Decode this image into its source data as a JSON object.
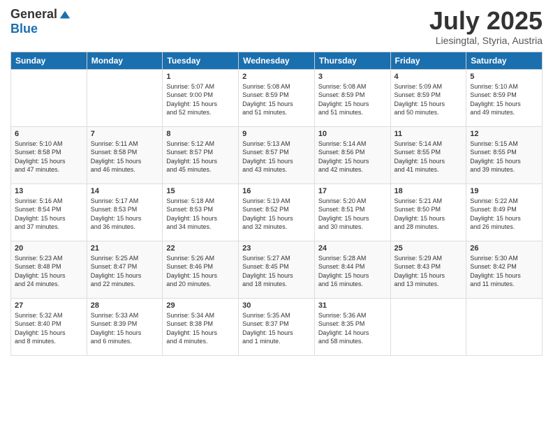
{
  "logo": {
    "general": "General",
    "blue": "Blue"
  },
  "header": {
    "month": "July 2025",
    "location": "Liesingtal, Styria, Austria"
  },
  "days": [
    "Sunday",
    "Monday",
    "Tuesday",
    "Wednesday",
    "Thursday",
    "Friday",
    "Saturday"
  ],
  "weeks": [
    [
      {
        "day": "",
        "content": ""
      },
      {
        "day": "",
        "content": ""
      },
      {
        "day": "1",
        "content": "Sunrise: 5:07 AM\nSunset: 9:00 PM\nDaylight: 15 hours\nand 52 minutes."
      },
      {
        "day": "2",
        "content": "Sunrise: 5:08 AM\nSunset: 8:59 PM\nDaylight: 15 hours\nand 51 minutes."
      },
      {
        "day": "3",
        "content": "Sunrise: 5:08 AM\nSunset: 8:59 PM\nDaylight: 15 hours\nand 51 minutes."
      },
      {
        "day": "4",
        "content": "Sunrise: 5:09 AM\nSunset: 8:59 PM\nDaylight: 15 hours\nand 50 minutes."
      },
      {
        "day": "5",
        "content": "Sunrise: 5:10 AM\nSunset: 8:59 PM\nDaylight: 15 hours\nand 49 minutes."
      }
    ],
    [
      {
        "day": "6",
        "content": "Sunrise: 5:10 AM\nSunset: 8:58 PM\nDaylight: 15 hours\nand 47 minutes."
      },
      {
        "day": "7",
        "content": "Sunrise: 5:11 AM\nSunset: 8:58 PM\nDaylight: 15 hours\nand 46 minutes."
      },
      {
        "day": "8",
        "content": "Sunrise: 5:12 AM\nSunset: 8:57 PM\nDaylight: 15 hours\nand 45 minutes."
      },
      {
        "day": "9",
        "content": "Sunrise: 5:13 AM\nSunset: 8:57 PM\nDaylight: 15 hours\nand 43 minutes."
      },
      {
        "day": "10",
        "content": "Sunrise: 5:14 AM\nSunset: 8:56 PM\nDaylight: 15 hours\nand 42 minutes."
      },
      {
        "day": "11",
        "content": "Sunrise: 5:14 AM\nSunset: 8:55 PM\nDaylight: 15 hours\nand 41 minutes."
      },
      {
        "day": "12",
        "content": "Sunrise: 5:15 AM\nSunset: 8:55 PM\nDaylight: 15 hours\nand 39 minutes."
      }
    ],
    [
      {
        "day": "13",
        "content": "Sunrise: 5:16 AM\nSunset: 8:54 PM\nDaylight: 15 hours\nand 37 minutes."
      },
      {
        "day": "14",
        "content": "Sunrise: 5:17 AM\nSunset: 8:53 PM\nDaylight: 15 hours\nand 36 minutes."
      },
      {
        "day": "15",
        "content": "Sunrise: 5:18 AM\nSunset: 8:53 PM\nDaylight: 15 hours\nand 34 minutes."
      },
      {
        "day": "16",
        "content": "Sunrise: 5:19 AM\nSunset: 8:52 PM\nDaylight: 15 hours\nand 32 minutes."
      },
      {
        "day": "17",
        "content": "Sunrise: 5:20 AM\nSunset: 8:51 PM\nDaylight: 15 hours\nand 30 minutes."
      },
      {
        "day": "18",
        "content": "Sunrise: 5:21 AM\nSunset: 8:50 PM\nDaylight: 15 hours\nand 28 minutes."
      },
      {
        "day": "19",
        "content": "Sunrise: 5:22 AM\nSunset: 8:49 PM\nDaylight: 15 hours\nand 26 minutes."
      }
    ],
    [
      {
        "day": "20",
        "content": "Sunrise: 5:23 AM\nSunset: 8:48 PM\nDaylight: 15 hours\nand 24 minutes."
      },
      {
        "day": "21",
        "content": "Sunrise: 5:25 AM\nSunset: 8:47 PM\nDaylight: 15 hours\nand 22 minutes."
      },
      {
        "day": "22",
        "content": "Sunrise: 5:26 AM\nSunset: 8:46 PM\nDaylight: 15 hours\nand 20 minutes."
      },
      {
        "day": "23",
        "content": "Sunrise: 5:27 AM\nSunset: 8:45 PM\nDaylight: 15 hours\nand 18 minutes."
      },
      {
        "day": "24",
        "content": "Sunrise: 5:28 AM\nSunset: 8:44 PM\nDaylight: 15 hours\nand 16 minutes."
      },
      {
        "day": "25",
        "content": "Sunrise: 5:29 AM\nSunset: 8:43 PM\nDaylight: 15 hours\nand 13 minutes."
      },
      {
        "day": "26",
        "content": "Sunrise: 5:30 AM\nSunset: 8:42 PM\nDaylight: 15 hours\nand 11 minutes."
      }
    ],
    [
      {
        "day": "27",
        "content": "Sunrise: 5:32 AM\nSunset: 8:40 PM\nDaylight: 15 hours\nand 8 minutes."
      },
      {
        "day": "28",
        "content": "Sunrise: 5:33 AM\nSunset: 8:39 PM\nDaylight: 15 hours\nand 6 minutes."
      },
      {
        "day": "29",
        "content": "Sunrise: 5:34 AM\nSunset: 8:38 PM\nDaylight: 15 hours\nand 4 minutes."
      },
      {
        "day": "30",
        "content": "Sunrise: 5:35 AM\nSunset: 8:37 PM\nDaylight: 15 hours\nand 1 minute."
      },
      {
        "day": "31",
        "content": "Sunrise: 5:36 AM\nSunset: 8:35 PM\nDaylight: 14 hours\nand 58 minutes."
      },
      {
        "day": "",
        "content": ""
      },
      {
        "day": "",
        "content": ""
      }
    ]
  ]
}
